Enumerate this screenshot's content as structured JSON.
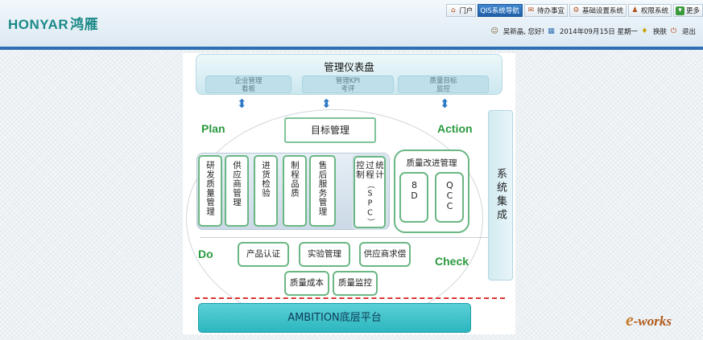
{
  "header": {
    "logo_en": "HONYAR",
    "logo_cn": "鸿雁",
    "nav": [
      {
        "icon": "home-icon",
        "glyph": "⌂",
        "label": "门户"
      },
      {
        "icon": "",
        "glyph": "",
        "label": "QIS系统导航",
        "active": true
      },
      {
        "icon": "mail-icon",
        "glyph": "✉",
        "label": "待办事宜"
      },
      {
        "icon": "gear-icon",
        "glyph": "⚙",
        "label": "基础设置系统"
      },
      {
        "icon": "user-icon",
        "glyph": "♟",
        "label": "权限系统"
      },
      {
        "icon": "more-icon",
        "glyph": "▾",
        "label": "更多"
      }
    ],
    "user_greeting": "吴新晶, 您好!",
    "date": "2014年09月15日 星期一",
    "skin_label": "换肤",
    "logout_label": "退出"
  },
  "diagram": {
    "dashboard_title": "管理仪表盘",
    "dashboard_items": [
      {
        "line1": "企业管理",
        "line2": "看板"
      },
      {
        "line1": "管理KPI",
        "line2": "考评"
      },
      {
        "line1": "质量目标",
        "line2": "监控"
      }
    ],
    "plan": "Plan",
    "action": "Action",
    "do": "Do",
    "check": "Check",
    "goal_mgmt": "目标管理",
    "modules": [
      "研发质量管理",
      "供应商管理",
      "进货检验",
      "制程品质",
      "售后服务管理"
    ],
    "spc_label": "（SPC）",
    "spc_text": "统计过程控制",
    "quality_improve": "质量改进管理",
    "q8d": "8D",
    "qcc": "QCC",
    "row2": [
      "产品认证",
      "实验管理",
      "供应商求偿"
    ],
    "row3": [
      "质量成本",
      "质量监控"
    ],
    "system_integration": "系统集成",
    "platform": "AMBITION底层平台"
  },
  "watermark": {
    "c": "e",
    "rest": "-works"
  }
}
